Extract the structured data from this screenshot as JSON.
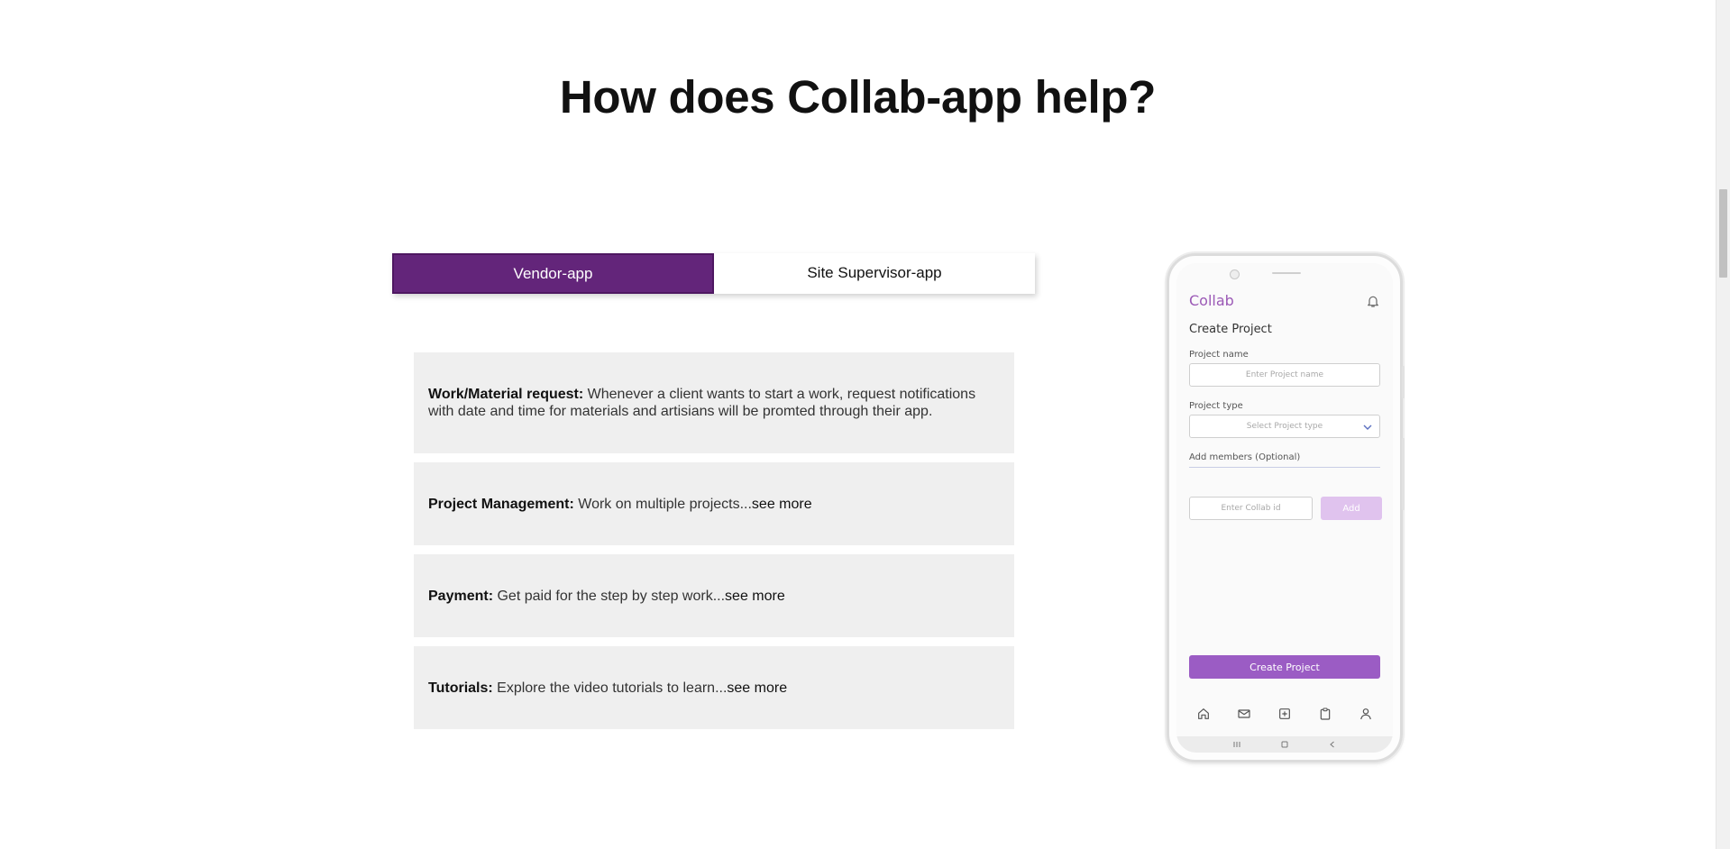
{
  "heading": "How does Collab-app help?",
  "tabs": [
    {
      "label": "Vendor-app",
      "active": true
    },
    {
      "label": "Site Supervisor-app",
      "active": false
    }
  ],
  "features": [
    {
      "title": "Work/Material request:",
      "text": " Whenever a client wants to start a work, request notifications with date and time for materials and artisians will be promted through their app.",
      "more": ""
    },
    {
      "title": "Project Management:",
      "text": " Work on multiple projects...",
      "more": "see more"
    },
    {
      "title": "Payment:",
      "text": " Get paid for the step by step work...",
      "more": "see more"
    },
    {
      "title": "Tutorials:",
      "text": " Explore the video tutorials to learn...",
      "more": "see more"
    }
  ],
  "phone": {
    "brand": "Collab",
    "screen_title": "Create Project",
    "project_name_label": "Project name",
    "project_name_placeholder": "Enter Project name",
    "project_type_label": "Project type",
    "project_type_placeholder": "Select Project type",
    "members_label": "Add members (Optional)",
    "collab_id_placeholder": "Enter Collab id",
    "add_label": "Add",
    "create_label": "Create Project",
    "nav_icons": [
      "home-icon",
      "mail-icon",
      "add-square-icon",
      "clipboard-icon",
      "profile-icon"
    ],
    "system_icons": [
      "recents-icon",
      "home-key-icon",
      "back-icon"
    ]
  },
  "colors": {
    "accent": "#63257a",
    "brand_purple": "#9b59b6",
    "button_purple": "#9b5cc4",
    "add_disabled": "#e0c3ee",
    "card_bg": "#efefef"
  }
}
